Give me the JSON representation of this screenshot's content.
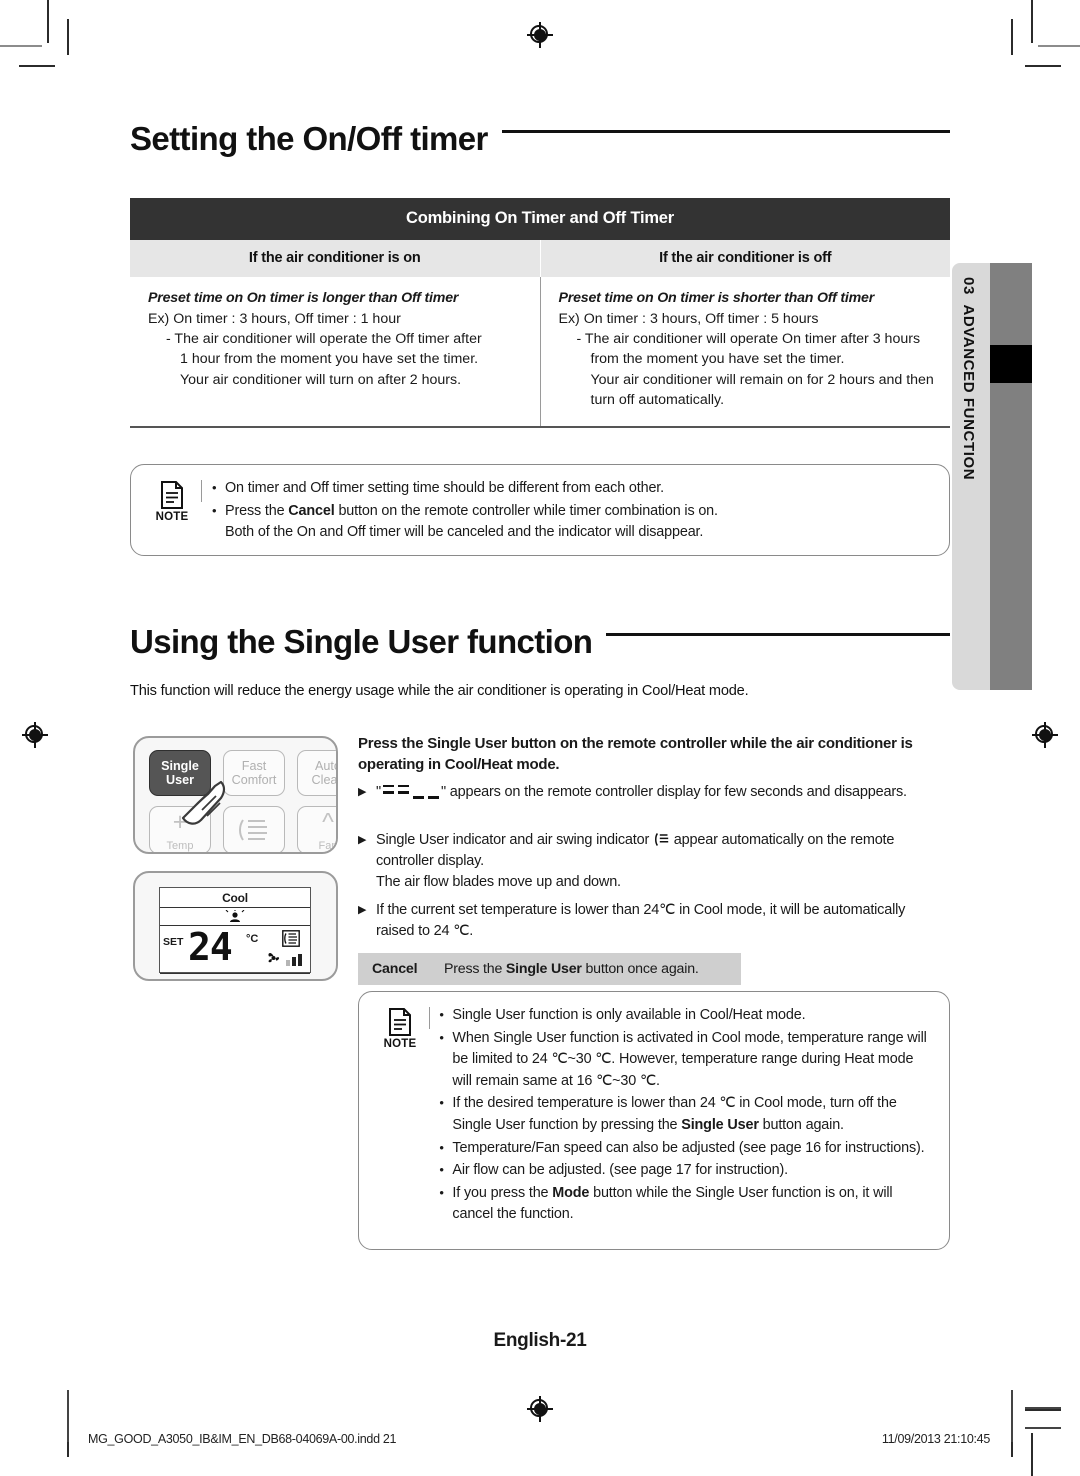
{
  "sections": {
    "timer": {
      "title": "Setting the On/Off timer",
      "table": {
        "main_header": "Combining On Timer and Off Timer",
        "sub_headers": [
          "If the air conditioner is on",
          "If the air conditioner is off"
        ],
        "cells": [
          {
            "emphasis": "Preset time on On timer is longer than Off timer",
            "example": "Ex) On timer : 3 hours, Off timer : 1 hour",
            "dash": "- The air conditioner will operate the Off timer after",
            "cont": [
              "1 hour from the moment you have set the timer.",
              "Your air conditioner will turn on after 2 hours."
            ]
          },
          {
            "emphasis": "Preset time on On timer is shorter than Off timer",
            "example": "Ex) On timer : 3 hours, Off timer : 5 hours",
            "dash": "- The air conditioner will operate On timer after 3 hours",
            "cont": [
              "from the moment you have set the timer.",
              "Your air conditioner will remain on for 2 hours and then",
              "turn off automatically."
            ]
          }
        ]
      },
      "note": {
        "label": "NOTE",
        "items": [
          {
            "main": "On timer and Off timer setting time should be different from each other.",
            "sub": ""
          },
          {
            "main_pre": "Press the ",
            "bold": "Cancel",
            "main_post": " button on the remote controller while timer combination is on.",
            "sub": "Both of the On and Off timer will be canceled and the indicator will disappear."
          }
        ]
      }
    },
    "single_user": {
      "title": "Using the Single User function",
      "intro": "This function will reduce the energy usage while the air conditioner is operating in Cool/Heat mode.",
      "remote": {
        "buttons": [
          {
            "line1": "Single",
            "line2": "User",
            "state": "active"
          },
          {
            "line1": "Fast",
            "line2": "Comfort",
            "state": "normal"
          },
          {
            "line1": "Auto",
            "line2": "Clean",
            "state": "normal"
          }
        ],
        "bottom_buttons": [
          {
            "glyph": "+",
            "caption": "Temp"
          },
          {
            "glyph": "swing-icon",
            "caption": ""
          },
          {
            "glyph": "^",
            "caption": "Fan"
          }
        ]
      },
      "lcd": {
        "mode": "Cool",
        "set_label": "SET",
        "temperature": "24",
        "unit": "°C",
        "fan_bars": 3,
        "fan_bars_total": 3
      },
      "lead": {
        "pre": "Press the ",
        "bold": "Single User",
        "post": " button on the remote controller while the air conditioner is operating in Cool/Heat mode."
      },
      "arrow_items": [
        {
          "prefix": "\"",
          "segment_display": true,
          "suffix": "\" appears on the remote controller display for few seconds and disappears."
        },
        {
          "text_pre": "Single User indicator and air swing indicator ",
          "inline_icon": "air-swing-icon",
          "text_post": " appear automatically on the remote controller display.",
          "extra_line": "The air flow blades move up and down."
        },
        {
          "text": "If the current set temperature is lower than 24℃ in Cool mode, it will be automatically raised to 24 ℃."
        }
      ],
      "cancel": {
        "label": "Cancel",
        "pre": "Press the ",
        "bold": "Single User",
        "post": " button once again."
      },
      "note": {
        "label": "NOTE",
        "items": [
          {
            "main": "Single User function is only available in Cool/Heat mode."
          },
          {
            "main": "When Single User function is activated in Cool mode, temperature range will be limited to 24 ℃~30 ℃. However, temperature range during Heat mode will remain same at 16 ℃~30 ℃."
          },
          {
            "main_pre": "If the desired temperature is lower than 24 ℃ in Cool mode, turn off the Single User function by pressing the ",
            "bold": "Single User",
            "main_post": " button again."
          },
          {
            "main": "Temperature/Fan speed can also be adjusted (see page 16 for instructions)."
          },
          {
            "main": "Air flow can be adjusted. (see page 17 for instruction)."
          },
          {
            "main_pre": "If you press the ",
            "bold": "Mode",
            "main_post": " button while the Single User function is on, it will cancel the function."
          }
        ]
      }
    }
  },
  "side_tab": {
    "chapter_number": "03",
    "chapter_name": "ADVANCED FUNCTION"
  },
  "footer": {
    "page_label": "English-21",
    "file_name": "MG_GOOD_A3050_IB&IM_EN_DB68-04069A-00.indd   21",
    "timestamp": "11/09/2013   21:10:45"
  }
}
